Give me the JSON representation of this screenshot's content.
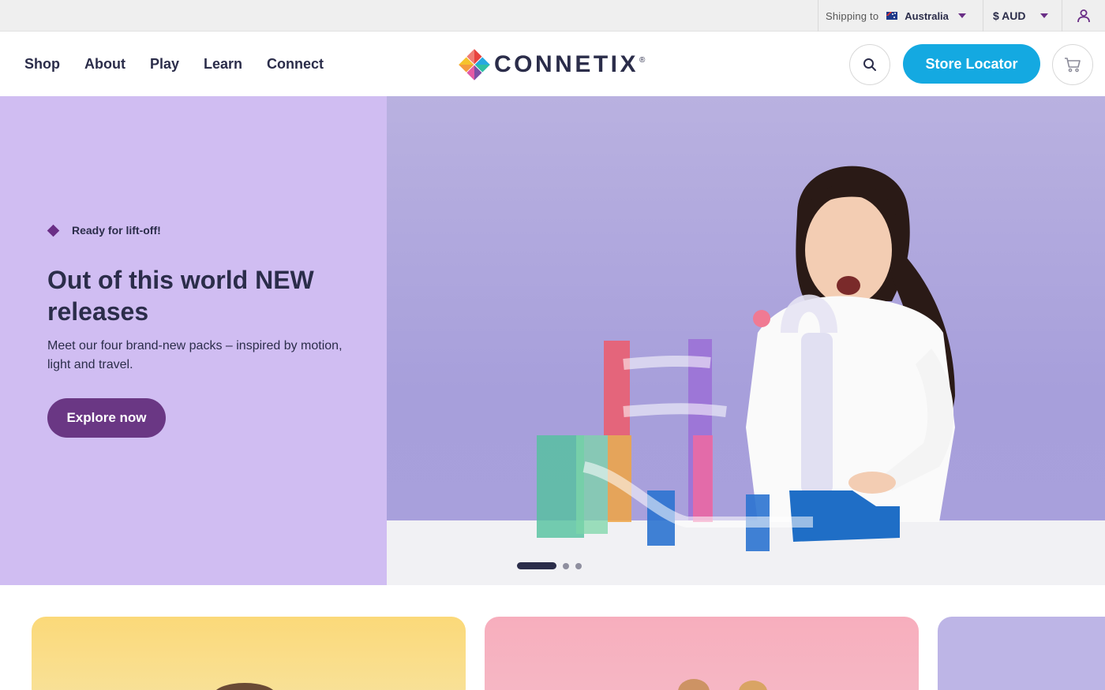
{
  "topbar": {
    "shipping_label": "Shipping to",
    "country": "Australia",
    "currency": "$ AUD"
  },
  "header": {
    "nav": [
      "Shop",
      "About",
      "Play",
      "Learn",
      "Connect"
    ],
    "logo_text": "CONNETIX",
    "logo_mark": "®",
    "store_locator": "Store Locator"
  },
  "hero": {
    "eyebrow": "Ready for lift-off!",
    "title": "Out of this world NEW releases",
    "subtitle": "Meet our four brand-new packs – inspired by motion, light and travel.",
    "cta": "Explore now",
    "carousel_total": 3,
    "carousel_active": 1
  },
  "icons": {
    "account": "user-icon",
    "search": "search-icon",
    "cart": "cart-icon",
    "caret": "caret-down-icon"
  },
  "colors": {
    "brand_navy": "#2b2d4a",
    "accent_blue": "#14a9e1",
    "accent_purple": "#6a3784",
    "hero_bg": "#d0bdf2",
    "caret": "#6a2e86"
  }
}
